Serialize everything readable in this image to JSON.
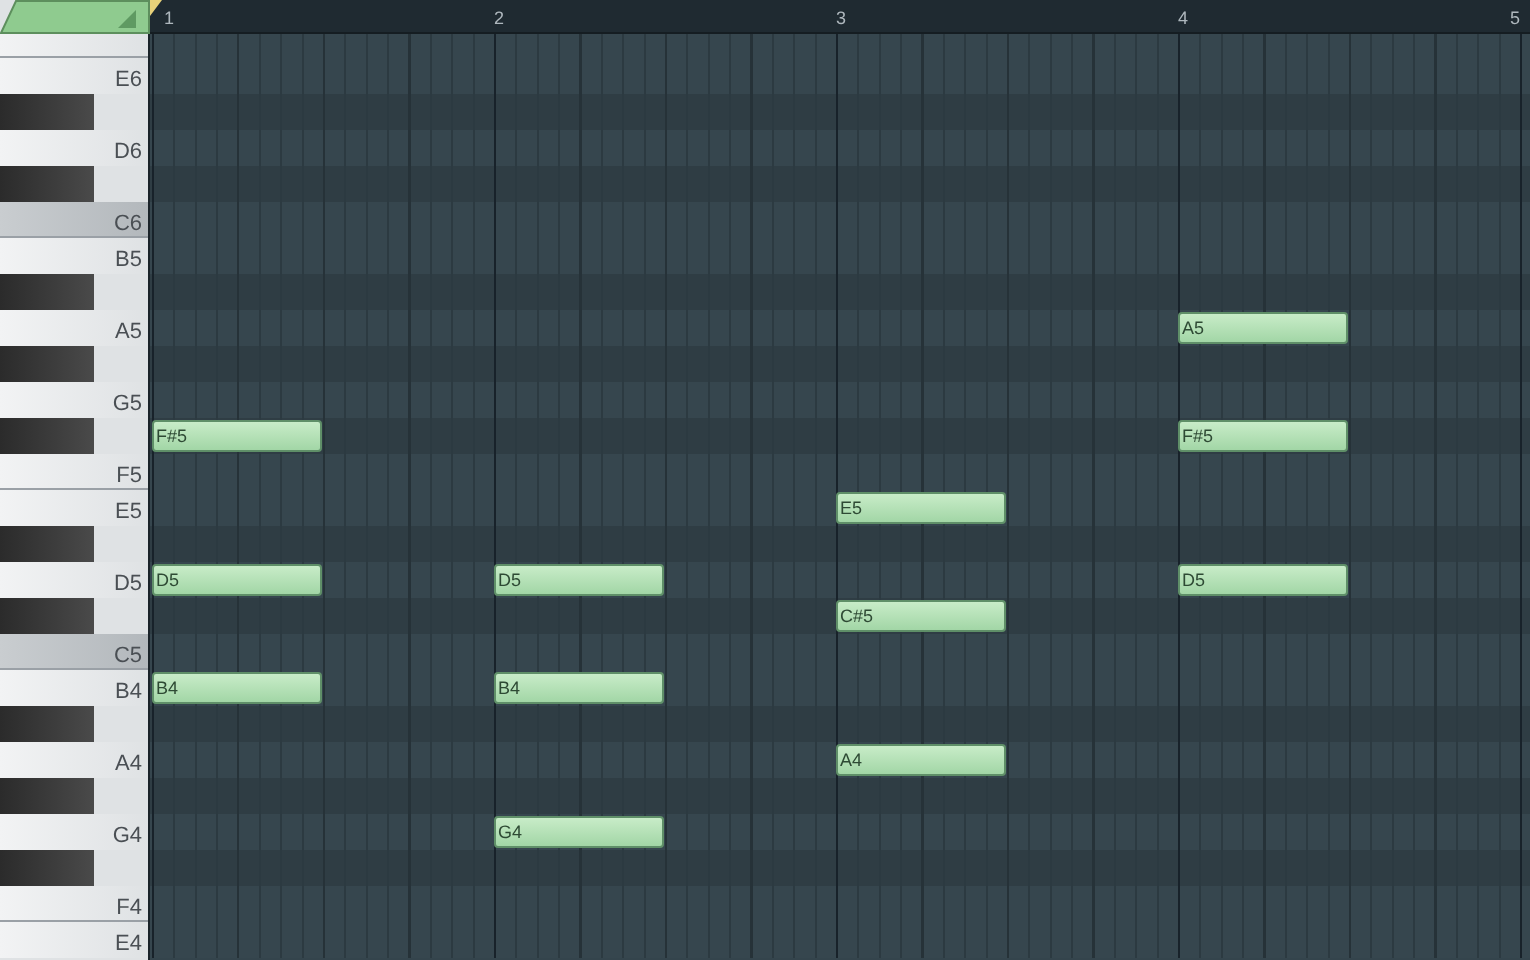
{
  "ruler": {
    "marks": [
      "1",
      "2",
      "3",
      "4",
      "5"
    ]
  },
  "keys": [
    {
      "kind": "f"
    },
    {
      "kind": "white",
      "label": "E6"
    },
    {
      "kind": "black"
    },
    {
      "kind": "white",
      "label": "D6"
    },
    {
      "kind": "black"
    },
    {
      "kind": "c",
      "label": "C6"
    },
    {
      "kind": "white",
      "label": "B5"
    },
    {
      "kind": "black"
    },
    {
      "kind": "white",
      "label": "A5",
      "bars": [
        {
          "has_note": false
        },
        {
          "has_note": false
        },
        {
          "has_note": false
        },
        {
          "has_note": true,
          "label": "A5"
        }
      ]
    },
    {
      "kind": "black"
    },
    {
      "kind": "white",
      "label": "G5"
    },
    {
      "kind": "black",
      "bars": [
        {
          "has_note": true,
          "label": "F#5"
        },
        {
          "has_note": false
        },
        {
          "has_note": false
        },
        {
          "has_note": true,
          "label": "F#5"
        }
      ]
    },
    {
      "kind": "f",
      "label": "F5"
    },
    {
      "kind": "white",
      "label": "E5",
      "bars": [
        {
          "has_note": false
        },
        {
          "has_note": false
        },
        {
          "has_note": true,
          "label": "E5"
        },
        {
          "has_note": false
        }
      ]
    },
    {
      "kind": "black"
    },
    {
      "kind": "white",
      "label": "D5",
      "bars": [
        {
          "has_note": true,
          "label": "D5"
        },
        {
          "has_note": true,
          "label": "D5"
        },
        {
          "has_note": false
        },
        {
          "has_note": true,
          "label": "D5"
        }
      ]
    },
    {
      "kind": "black",
      "bars": [
        {
          "has_note": false
        },
        {
          "has_note": false
        },
        {
          "has_note": true,
          "label": "C#5"
        },
        {
          "has_note": false
        }
      ]
    },
    {
      "kind": "c",
      "label": "C5"
    },
    {
      "kind": "white",
      "label": "B4",
      "bars": [
        {
          "has_note": true,
          "label": "B4"
        },
        {
          "has_note": true,
          "label": "B4"
        },
        {
          "has_note": false
        },
        {
          "has_note": false
        }
      ]
    },
    {
      "kind": "black"
    },
    {
      "kind": "white",
      "label": "A4",
      "bars": [
        {
          "has_note": false
        },
        {
          "has_note": false
        },
        {
          "has_note": true,
          "label": "A4"
        },
        {
          "has_note": false
        }
      ]
    },
    {
      "kind": "black"
    },
    {
      "kind": "white",
      "label": "G4",
      "bars": [
        {
          "has_note": false
        },
        {
          "has_note": true,
          "label": "G4"
        },
        {
          "has_note": false
        },
        {
          "has_note": false
        }
      ]
    },
    {
      "kind": "black"
    },
    {
      "kind": "f",
      "label": "F4"
    },
    {
      "kind": "white",
      "label": "E4"
    }
  ]
}
